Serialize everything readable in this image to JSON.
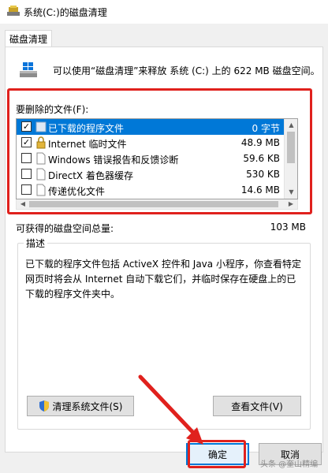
{
  "window": {
    "title": "系统(C:)的磁盘清理"
  },
  "tabs": [
    {
      "label": "磁盘清理"
    }
  ],
  "intro_text": "可以使用“磁盘清理”来释放 系统 (C:) 上的 622 MB 磁盘空间。",
  "files_label": "要删除的文件(F):",
  "files": [
    {
      "name": "已下载的程序文件",
      "size": "0 字节",
      "checked": true,
      "selected": true,
      "icon": "folder-icon"
    },
    {
      "name": "Internet 临时文件",
      "size": "48.9 MB",
      "checked": true,
      "selected": false,
      "icon": "lock-icon"
    },
    {
      "name": "Windows 错误报告和反馈诊断",
      "size": "59.6 KB",
      "checked": false,
      "selected": false,
      "icon": "file-icon"
    },
    {
      "name": "DirectX 着色器缓存",
      "size": "530 KB",
      "checked": false,
      "selected": false,
      "icon": "file-icon"
    },
    {
      "name": "传递优化文件",
      "size": "14.6 MB",
      "checked": false,
      "selected": false,
      "icon": "file-icon"
    }
  ],
  "total": {
    "label": "可获得的磁盘空间总量:",
    "value": "103 MB"
  },
  "description": {
    "title": "描述",
    "text": "已下载的程序文件包括 ActiveX 控件和 Java 小程序，你查看特定网页时将会从 Internet 自动下载它们，并临时保存在硬盘上的已下载的程序文件夹中。"
  },
  "buttons": {
    "clean_system": "清理系统文件(S)",
    "view_files": "查看文件(V)",
    "ok": "确定",
    "cancel": "取消"
  },
  "watermark": "头条 @奎山精编",
  "colors": {
    "accent": "#0078d7",
    "highlight_red": "#e0211d"
  }
}
